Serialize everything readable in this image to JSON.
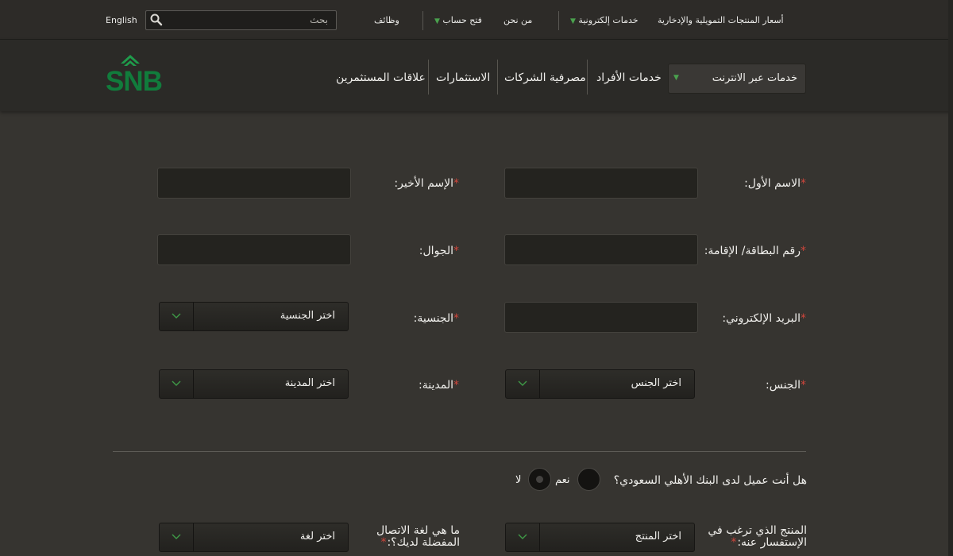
{
  "topbar": {
    "english": "English",
    "search_placeholder": "بحث",
    "jobs": "وظائف",
    "open_account": "فتح حساب",
    "about": "من نحن",
    "e_services": "خدمات إلكترونية",
    "prices": "أسعار المنتجات التمويلية والإدخارية"
  },
  "logo": {
    "text": "SNB"
  },
  "nav": {
    "online_services": "خدمات عبر الانترنت",
    "individuals": "خدمات الأفراد",
    "corporate": "مصرفية الشركات",
    "investments": "الاستثمارات",
    "investor_relations": "علاقات المستثمرين"
  },
  "form": {
    "required_mark": "*",
    "first_name_label": "الاسم الأول:",
    "last_name_label": "الإسم الأخير:",
    "id_label": "رقم البطاقة/ الإقامة:",
    "mobile_label": "الجوال:",
    "email_label": "البريد الإلكتروني:",
    "nationality_label": "الجنسية:",
    "nationality_value": "اختر الجنسية",
    "gender_label": "الجنس:",
    "gender_value": "اختر الجنس",
    "city_label": "المدينة:",
    "city_value": "اختر المدينة",
    "customer_question": "هل أنت عميل لدى البنك الأهلي السعودي؟",
    "yes": "نعم",
    "no": "لا",
    "product_label": "المنتج الذي ترغب في الإستفسار عنه:",
    "product_value": "اختر المنتج",
    "language_label": "ما هي لغة الاتصال المفضلة لديك؟:",
    "language_value": "اختر لغة"
  },
  "colors": {
    "brand_green": "#1a9a4a",
    "required_red": "#d0463c",
    "accent_caret": "#4aa24e"
  }
}
